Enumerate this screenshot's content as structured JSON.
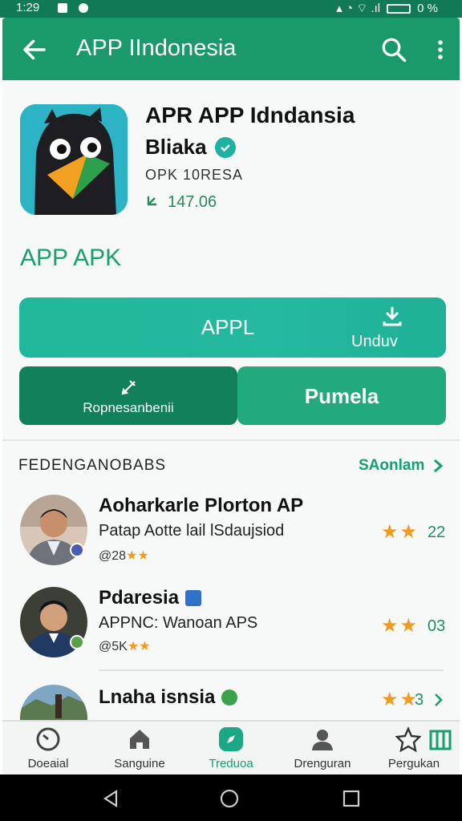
{
  "status_bar": {
    "time": "1:29",
    "battery": "0 %"
  },
  "app_bar": {
    "title": "APP IIndonesia"
  },
  "app": {
    "name": "APR APP Idndansia",
    "subtitle": "Bliaka",
    "developer": "OPK 10RESA",
    "downloads": "147.06"
  },
  "section_title": "APP APK",
  "buttons": {
    "main_label": "APPL",
    "download_label": "Unduv",
    "left_label": "Ropnesanbenii",
    "right_label": "Pumela"
  },
  "list": {
    "header": "FEDENGANOBABS",
    "see_all": "SAonlam",
    "items": [
      {
        "name": "Aoharkarle Plorton AP",
        "desc": "Patap Aotte lail lSdaujsiod",
        "meta": "@28",
        "stars": "★★",
        "count": "22"
      },
      {
        "name": "Pdaresia",
        "desc": "APPNC: Wanoan APS",
        "meta": "@5K",
        "stars": "★★",
        "count": "03"
      },
      {
        "name": "Lnaha isnsia",
        "desc": "",
        "meta": "",
        "stars": "★★",
        "count": "3"
      }
    ]
  },
  "bottom_nav": [
    {
      "label": "Doeaial",
      "icon": "dashboard-icon"
    },
    {
      "label": "Sanguine",
      "icon": "home-icon"
    },
    {
      "label": "Treduoa",
      "icon": "compass-icon"
    },
    {
      "label": "Drenguran",
      "icon": "profile-icon"
    },
    {
      "label": "Pergukan",
      "icon": "star-icon"
    }
  ],
  "colors": {
    "primary": "#1a9a6b",
    "accent": "#25b9a0",
    "dark": "#12805a",
    "star": "#f39a1e"
  }
}
